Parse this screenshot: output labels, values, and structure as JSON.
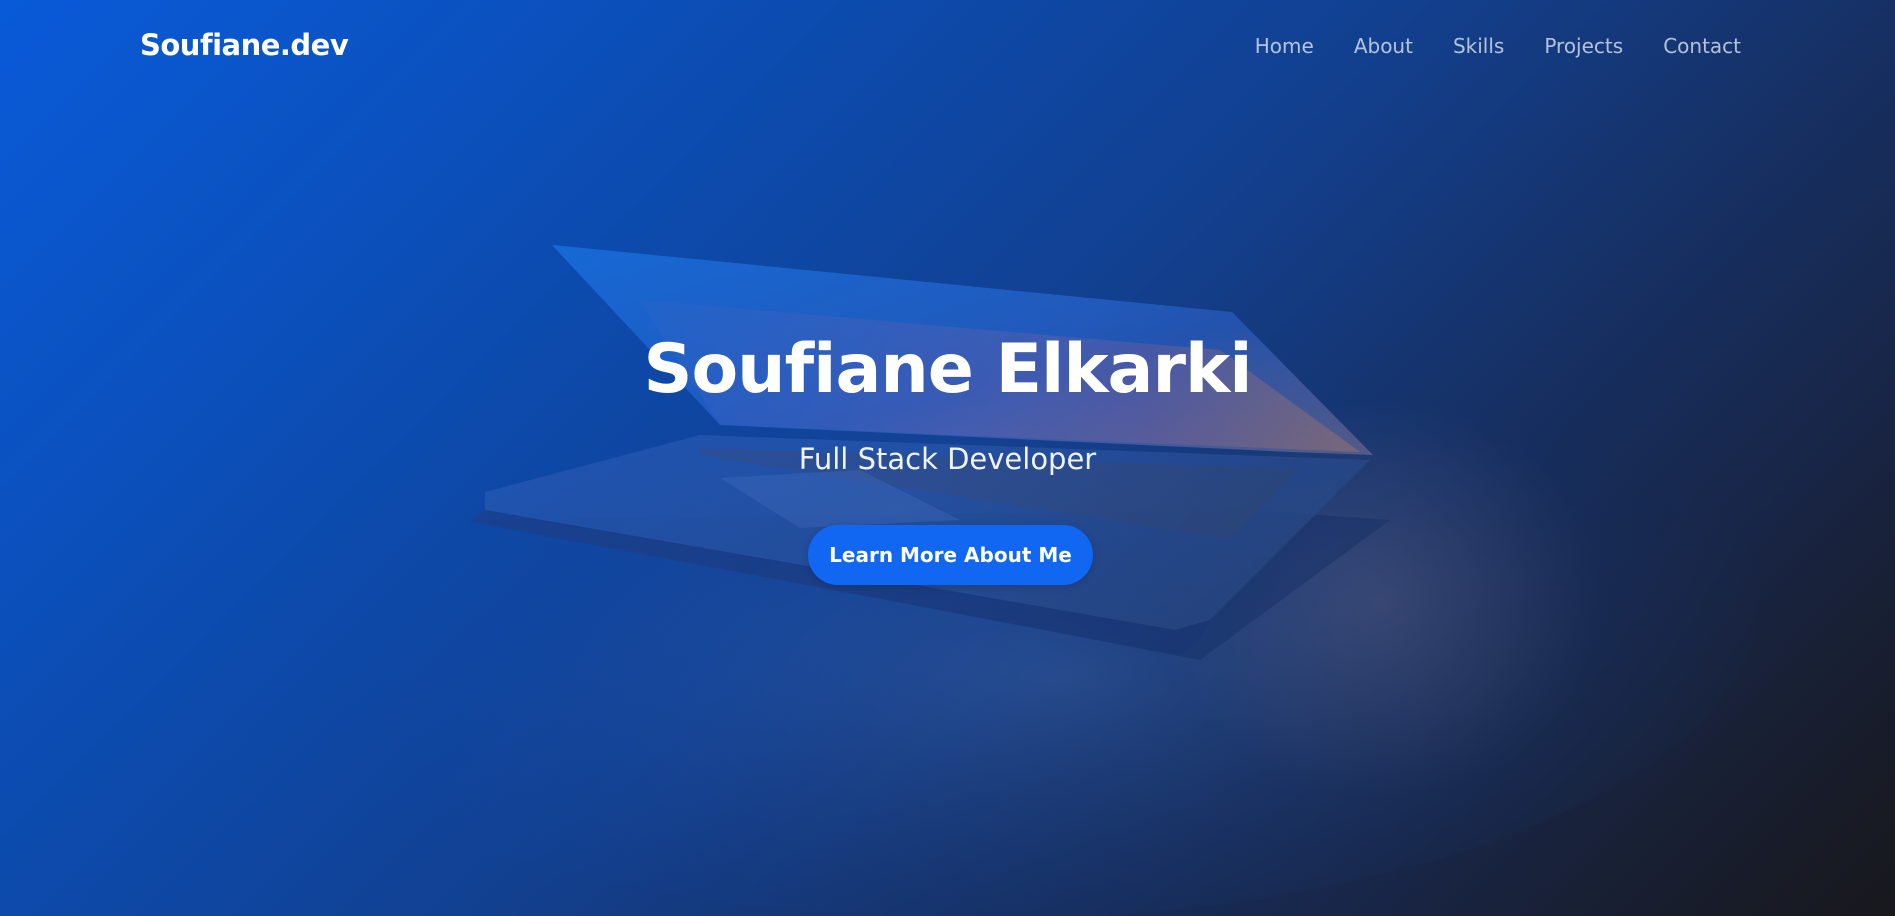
{
  "navbar": {
    "brand": "Soufiane.dev",
    "links": [
      "Home",
      "About",
      "Skills",
      "Projects",
      "Contact"
    ]
  },
  "hero": {
    "name": "Soufiane Elkarki",
    "subtitle": "Full Stack Developer",
    "cta_label": "Learn More About Me"
  },
  "colors": {
    "accent": "#1166f2",
    "gradient_start": "#0a5ad6",
    "gradient_end": "#1c1d22"
  }
}
